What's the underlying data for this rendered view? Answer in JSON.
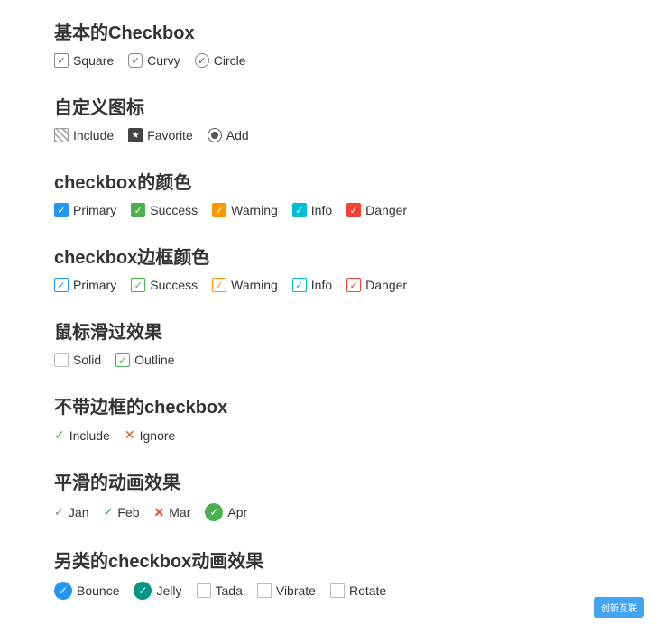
{
  "sections": [
    {
      "id": "basic-checkbox",
      "title": "基本的Checkbox",
      "items": [
        {
          "label": "Square",
          "type": "square",
          "checked": true
        },
        {
          "label": "Curvy",
          "type": "curvy",
          "checked": true
        },
        {
          "label": "Circle",
          "type": "circle",
          "checked": true
        }
      ]
    },
    {
      "id": "custom-icon",
      "title": "自定义图标",
      "items": [
        {
          "label": "Include",
          "type": "hatch",
          "checked": true
        },
        {
          "label": "Favorite",
          "type": "star",
          "checked": true
        },
        {
          "label": "Add",
          "type": "radio",
          "checked": true
        }
      ]
    },
    {
      "id": "checkbox-color",
      "title": "checkbox的颜色",
      "items": [
        {
          "label": "Primary",
          "type": "primary-filled"
        },
        {
          "label": "Success",
          "type": "success-filled"
        },
        {
          "label": "Warning",
          "type": "warning-filled"
        },
        {
          "label": "Info",
          "type": "info-filled"
        },
        {
          "label": "Danger",
          "type": "danger-filled"
        }
      ]
    },
    {
      "id": "checkbox-border-color",
      "title": "checkbox边框颜色",
      "items": [
        {
          "label": "Primary",
          "type": "primary-border"
        },
        {
          "label": "Success",
          "type": "success-border"
        },
        {
          "label": "Warning",
          "type": "warning-border"
        },
        {
          "label": "Info",
          "type": "info-border"
        },
        {
          "label": "Danger",
          "type": "danger-border"
        }
      ]
    },
    {
      "id": "hover-effect",
      "title": "鼠标滑过效果",
      "items": [
        {
          "label": "Solid",
          "type": "empty"
        },
        {
          "label": "Outline",
          "type": "outline-check"
        }
      ]
    },
    {
      "id": "no-border",
      "title": "不带边框的checkbox",
      "items": [
        {
          "label": "Include",
          "type": "nobox-green"
        },
        {
          "label": "Ignore",
          "type": "nobox-red"
        }
      ]
    },
    {
      "id": "smooth-animation",
      "title": "平滑的动画效果",
      "items": [
        {
          "label": "Jan",
          "type": "check-gray"
        },
        {
          "label": "Feb",
          "type": "check-teal"
        },
        {
          "label": "Mar",
          "type": "check-cross"
        },
        {
          "label": "Apr",
          "type": "check-circle-green"
        }
      ]
    },
    {
      "id": "other-animation",
      "title": "另类的checkbox动画效果",
      "items": [
        {
          "label": "Bounce",
          "type": "circle-blue"
        },
        {
          "label": "Jelly",
          "type": "circle-teal"
        },
        {
          "label": "Tada",
          "type": "empty-sm"
        },
        {
          "label": "Vibrate",
          "type": "empty-sm"
        },
        {
          "label": "Rotate",
          "type": "empty-sm"
        }
      ]
    }
  ],
  "watermark": "创新互联"
}
